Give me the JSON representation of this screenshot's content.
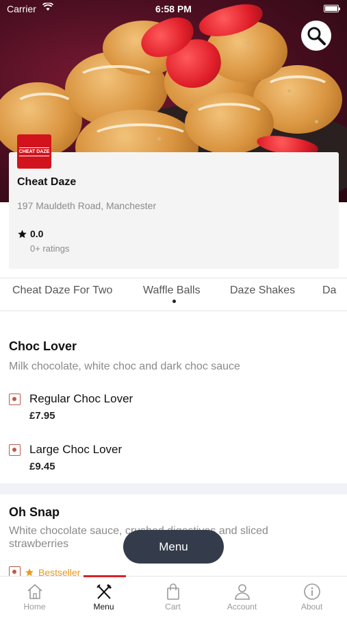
{
  "status_bar": {
    "carrier": "Carrier",
    "time": "6:58 PM"
  },
  "restaurant": {
    "logo_text": "CHEAT DAZE",
    "name": "Cheat Daze",
    "address": "197 Mauldeth Road, Manchester",
    "rating": "0.0",
    "rating_count": "0+ ratings"
  },
  "tabs": [
    {
      "label": "Cheat Daze For Two",
      "active": false
    },
    {
      "label": "Waffle Balls",
      "active": true
    },
    {
      "label": "Daze Shakes",
      "active": false
    },
    {
      "label": "Da",
      "active": false
    }
  ],
  "sections": [
    {
      "title": "Choc Lover",
      "description": "Milk chocolate, white choc and dark choc sauce",
      "items": [
        {
          "name": "Regular Choc Lover",
          "price": "£7.95"
        },
        {
          "name": "Large Choc Lover",
          "price": "£9.45"
        }
      ]
    },
    {
      "title": "Oh Snap",
      "description": "White chocolate sauce, crushed digestives and sliced strawberries",
      "badge": "Bestseller"
    }
  ],
  "floating_button": {
    "label": "Menu"
  },
  "bottom_nav": [
    {
      "label": "Home",
      "icon": "home-icon",
      "active": false
    },
    {
      "label": "Menu",
      "icon": "utensils-icon",
      "active": true
    },
    {
      "label": "Cart",
      "icon": "bag-icon",
      "active": false
    },
    {
      "label": "Account",
      "icon": "user-icon",
      "active": false
    },
    {
      "label": "About",
      "icon": "info-icon",
      "active": false
    }
  ],
  "colors": {
    "accent": "#d8232a",
    "brand_logo": "#d2131d",
    "bestseller": "#e89a1c",
    "floating_button": "#343b4b"
  }
}
